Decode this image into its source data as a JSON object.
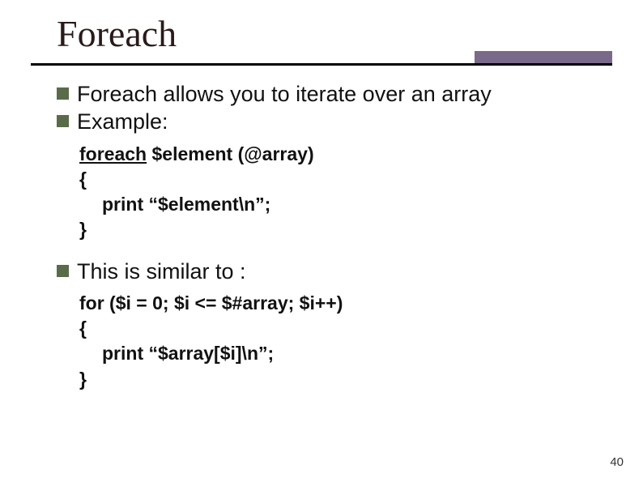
{
  "title": "Foreach",
  "bullets": {
    "b1": "Foreach allows you to iterate over an array",
    "b2": "Example:",
    "b3": "This is similar to :"
  },
  "code1": {
    "kw": "foreach",
    "rest": " $element (@array)",
    "open": "{",
    "body": "print “$element\\n”;",
    "close": "}"
  },
  "code2": {
    "line1": "for ($i = 0; $i <= $#array; $i++)",
    "open": "{",
    "body": "print “$array[$i]\\n”;",
    "close": "}"
  },
  "slide_number": "40"
}
